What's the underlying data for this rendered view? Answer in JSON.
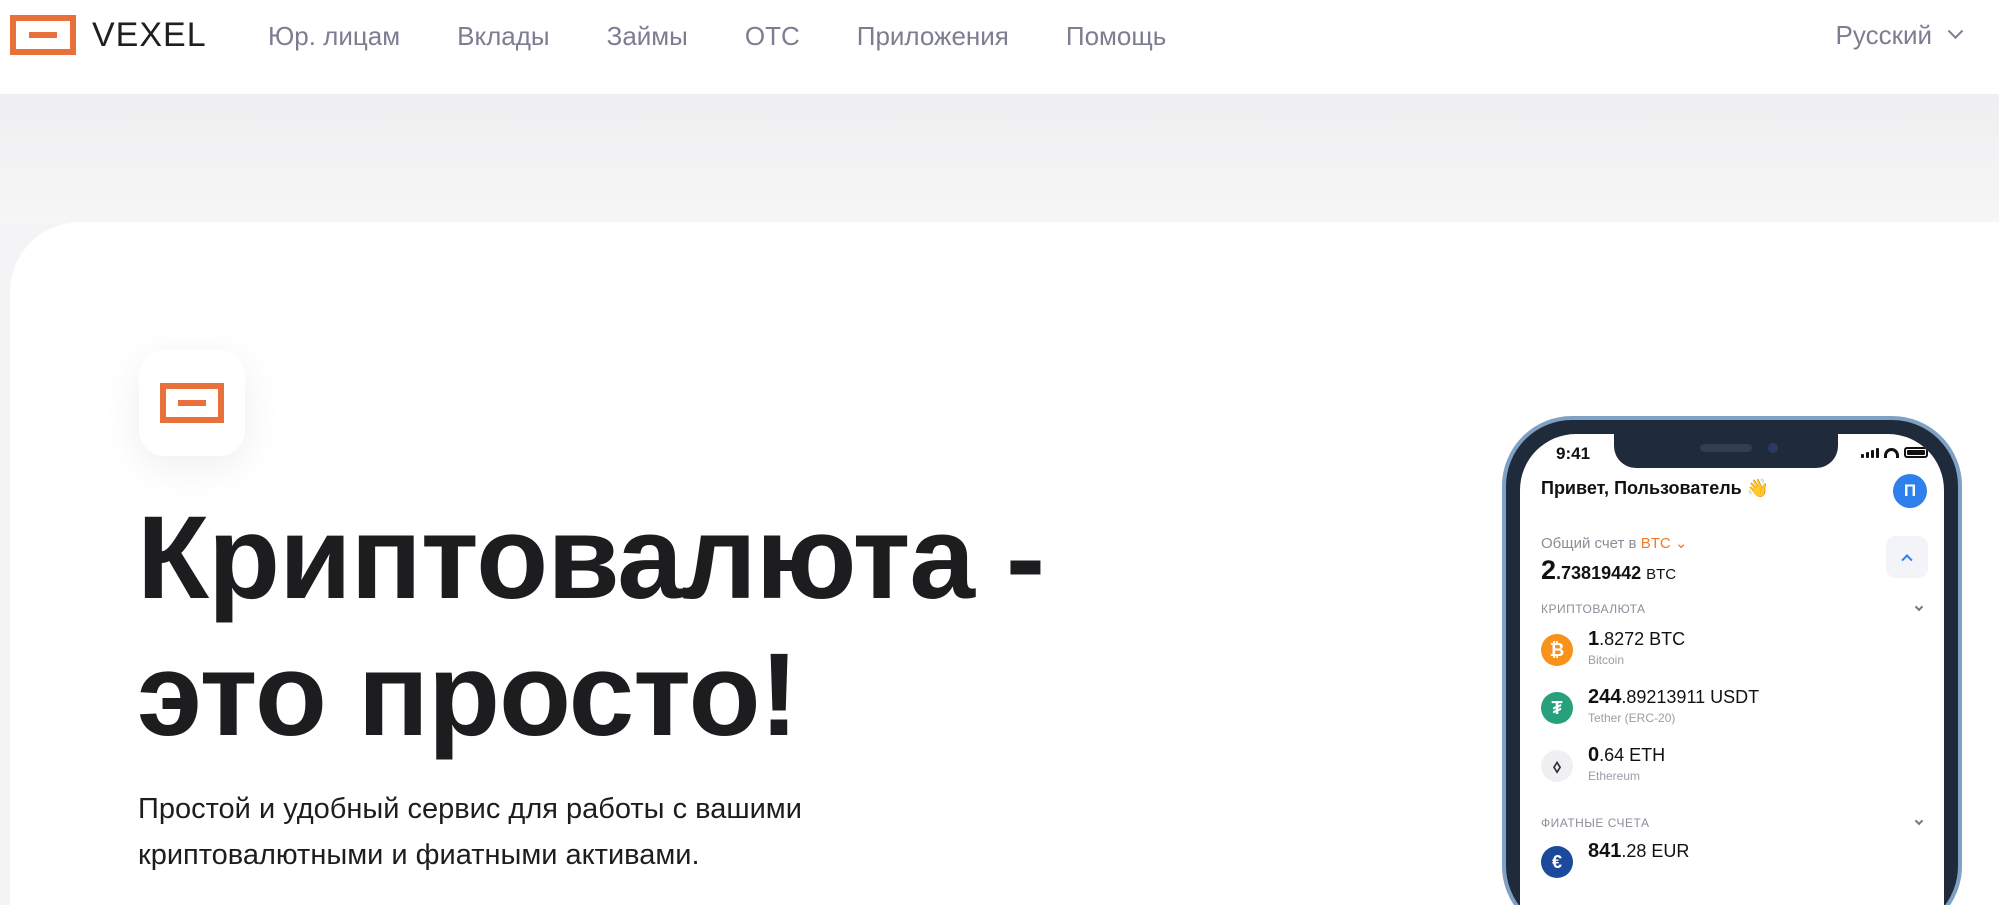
{
  "header": {
    "brand": "VEXEL",
    "nav": [
      "Юр. лицам",
      "Вклады",
      "Займы",
      "OTC",
      "Приложения",
      "Помощь"
    ],
    "language": "Русский"
  },
  "hero": {
    "title_line1": "Криптовалюта -",
    "title_line2": "это просто!",
    "subtitle_line1": "Простой и удобный сервис для работы с вашими",
    "subtitle_line2": "криптовалютными и фиатными активами."
  },
  "phone": {
    "time": "9:41",
    "greeting": "Привет, Пользователь 👋",
    "avatar_letter": "П",
    "total_label": "Общий счет в",
    "total_currency": "BTC",
    "total_int": "2",
    "total_dec": ".73819442",
    "total_unit": "BTC",
    "crypto_section": "КРИПТОВАЛЮТА",
    "fiat_section": "ФИАТНЫЕ СЧЕТА",
    "assets": [
      {
        "icon": "₿",
        "color": "#f7931a",
        "int": "1",
        "rest": ".8272 BTC",
        "name": "Bitcoin"
      },
      {
        "icon": "₮",
        "color": "#26a17b",
        "int": "244",
        "rest": ".89213911 USDT",
        "name": "Tether (ERC-20)"
      },
      {
        "icon": "⬨",
        "color": "#f0f0f3",
        "int": "0",
        "rest": ".64 ETH",
        "name": "Ethereum"
      }
    ],
    "fiat": [
      {
        "icon": "€",
        "color": "#1b4a9c",
        "int": "841",
        "rest": ".28 EUR"
      }
    ]
  },
  "colors": {
    "brand_orange": "#e8703a",
    "nav_text": "#7d7d92",
    "accent_blue": "#2f80ed"
  }
}
